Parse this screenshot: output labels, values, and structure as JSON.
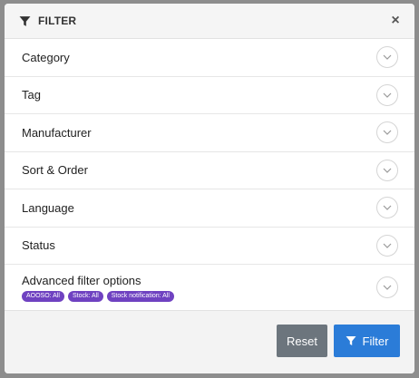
{
  "dialog": {
    "title": "FILTER",
    "close_symbol": "×",
    "title_icon": "filter-icon"
  },
  "sections": [
    {
      "label": "Category"
    },
    {
      "label": "Tag"
    },
    {
      "label": "Manufacturer"
    },
    {
      "label": "Sort & Order"
    },
    {
      "label": "Language"
    },
    {
      "label": "Status"
    },
    {
      "label": "Advanced filter options"
    }
  ],
  "advanced_chips": [
    "AOOSO: All",
    "Stock: All",
    "Stock notification: All"
  ],
  "footer": {
    "reset_label": "Reset",
    "filter_label": "Filter"
  },
  "colors": {
    "chip": "#6f42c1",
    "reset_button": "#6c757d",
    "filter_button": "#2b7cd8"
  }
}
